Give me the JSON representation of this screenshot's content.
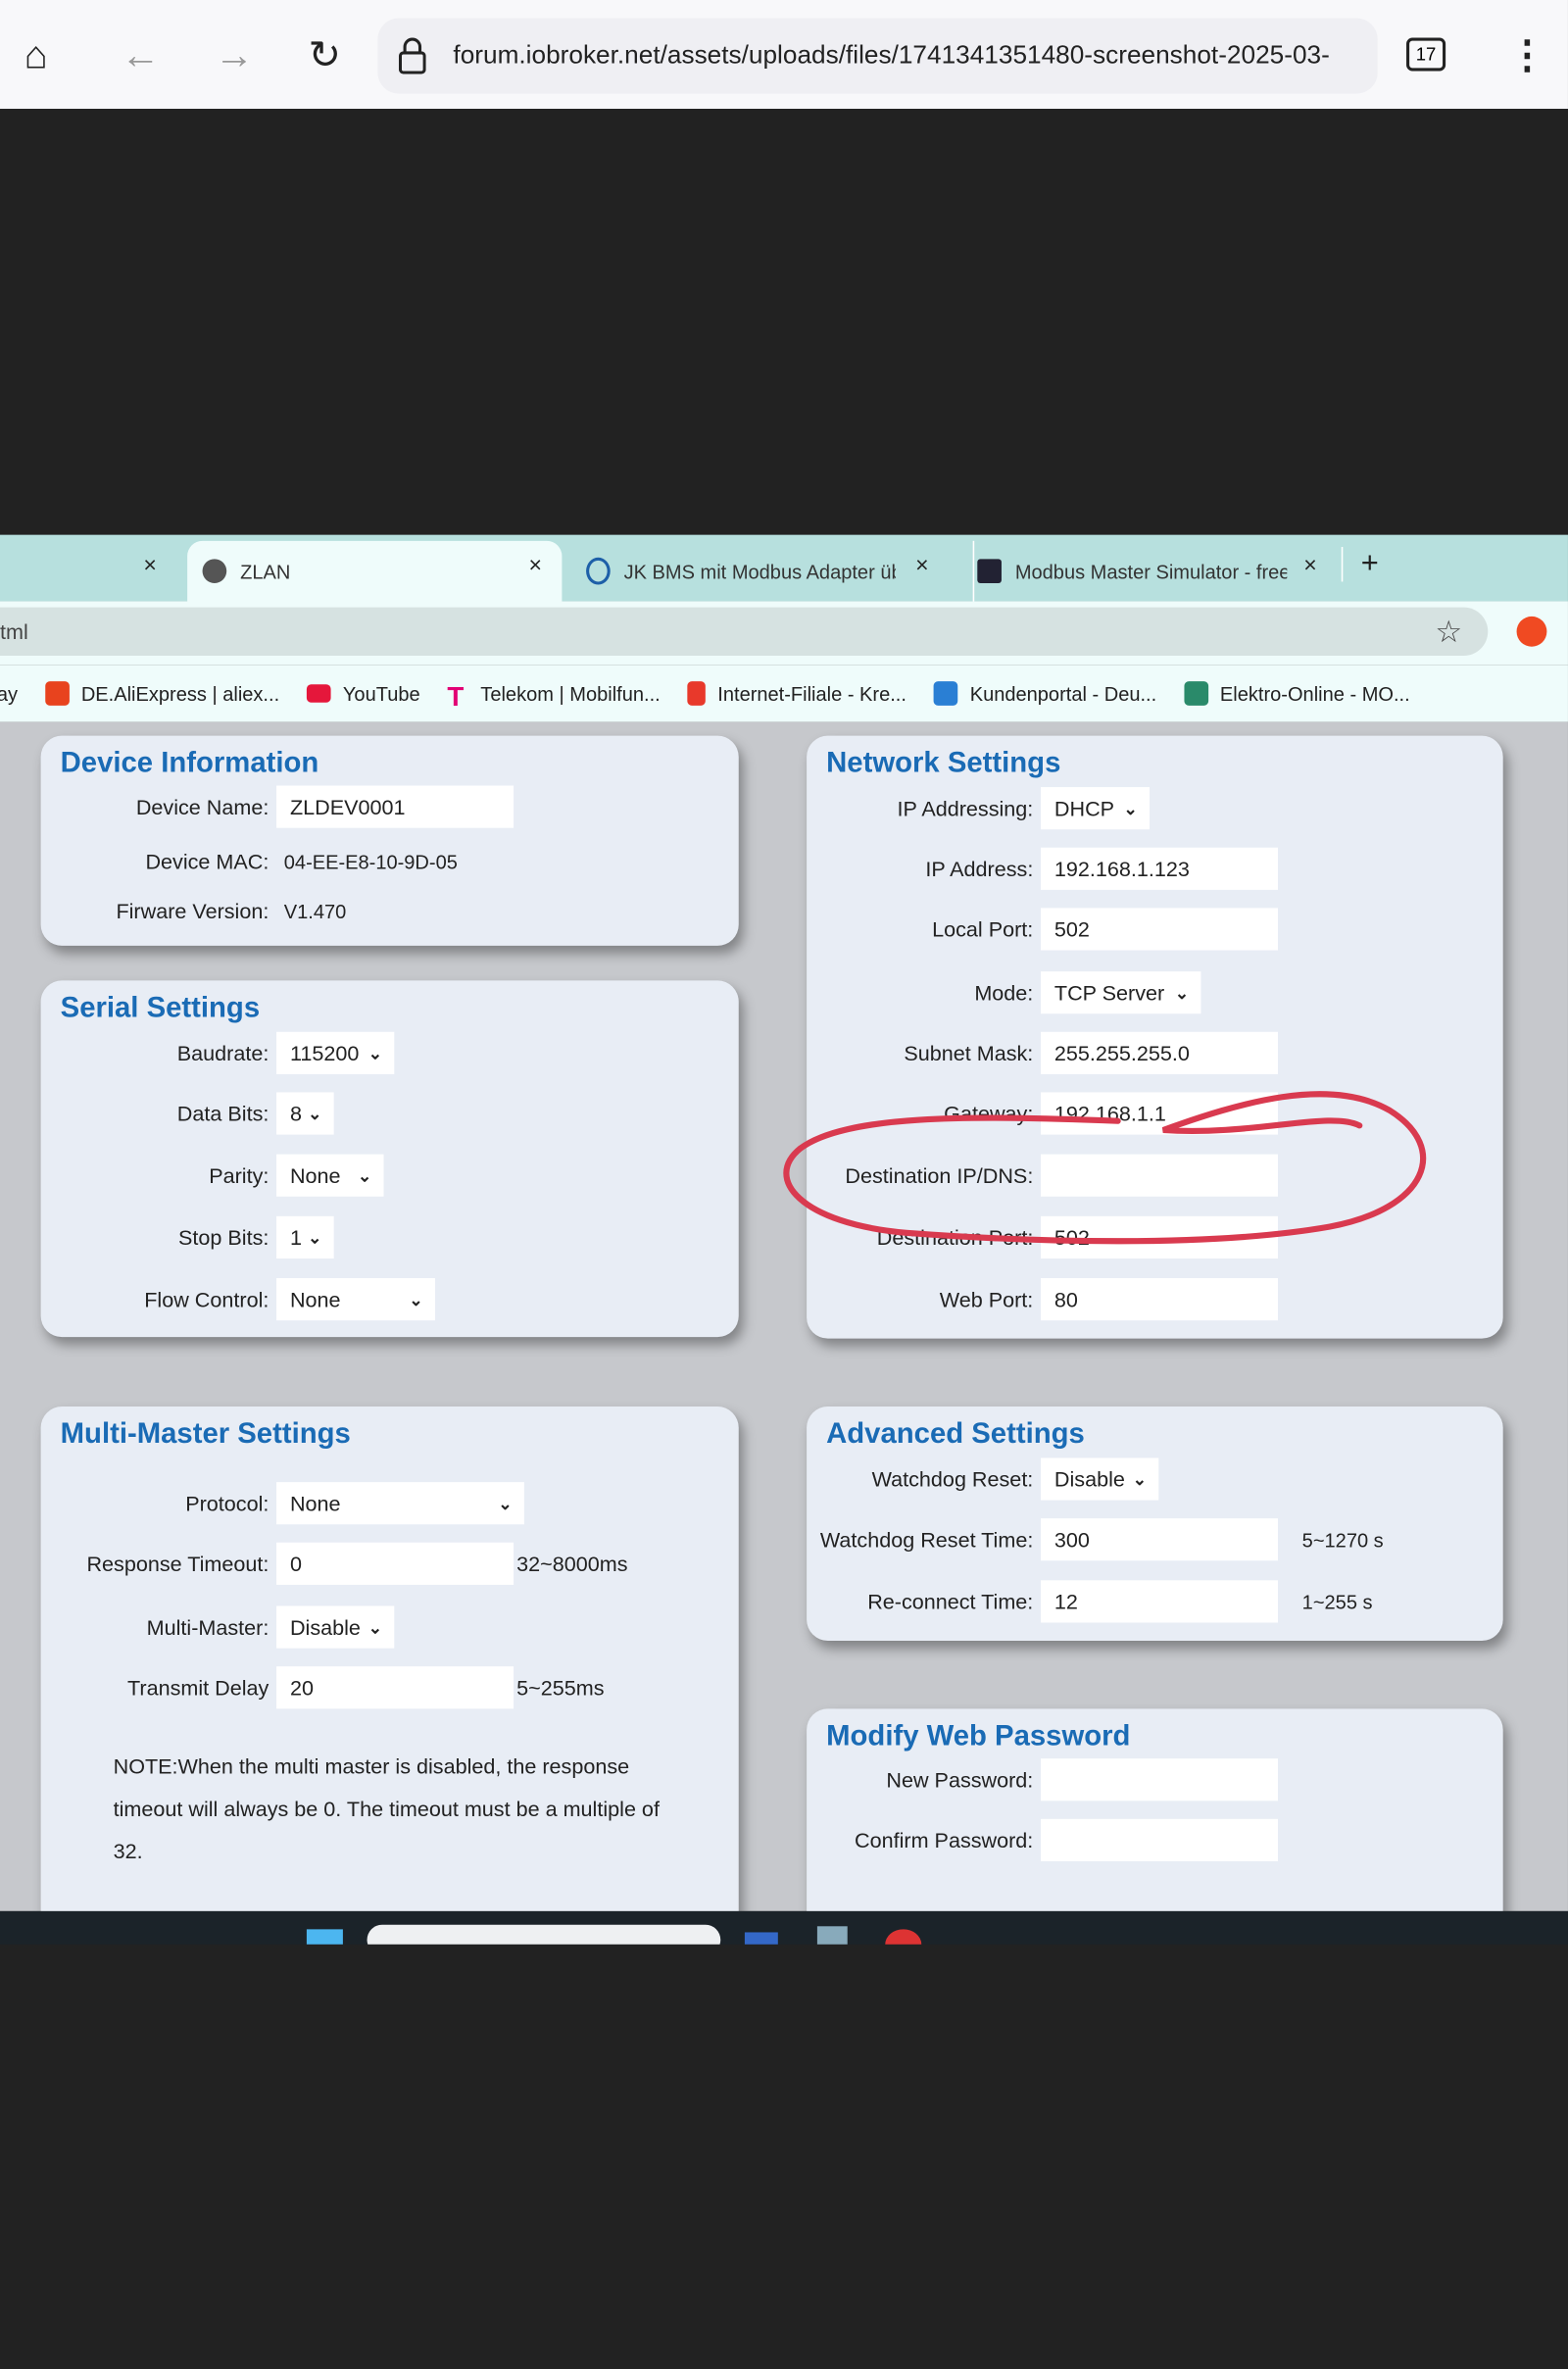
{
  "browser": {
    "url": "forum.iobroker.net/assets/uploads/files/1741341351480-screenshot-2025-03-",
    "tab_count": "17",
    "icons": [
      "home-icon",
      "back-icon",
      "forward-icon",
      "reload-icon",
      "lock-icon",
      "tabs-icon",
      "menu-icon"
    ]
  },
  "inner_browser": {
    "tabs": [
      {
        "label": "ZLAN",
        "active": true
      },
      {
        "label": "JK BMS mit Modbus Adapter üb",
        "active": false
      },
      {
        "label": "Modbus Master Simulator - free",
        "active": false
      }
    ],
    "close_glyph": "×",
    "new_tab_glyph": "+",
    "address_text": "tml",
    "bookmarks": [
      {
        "label": "ay",
        "color": ""
      },
      {
        "label": "DE.AliExpress | aliex...",
        "color": "#e8431e"
      },
      {
        "label": "YouTube",
        "color": "#e5173b"
      },
      {
        "label": "Telekom | Mobilfun...",
        "color": "#e20074"
      },
      {
        "label": "Internet-Filiale - Kre...",
        "color": "#e8392b"
      },
      {
        "label": "Kundenportal - Deu...",
        "color": "#2a7fd4"
      },
      {
        "label": "Elektro-Online - MO...",
        "color": "#2a8a6a"
      }
    ]
  },
  "device_info": {
    "title": "Device Information",
    "device_name_label": "Device Name:",
    "device_name": "ZLDEV0001",
    "mac_label": "Device MAC:",
    "mac": "04-EE-E8-10-9D-05",
    "fw_label": "Firware Version:",
    "fw": "V1.470"
  },
  "serial": {
    "title": "Serial Settings",
    "baudrate_label": "Baudrate:",
    "baudrate": "115200",
    "databits_label": "Data Bits:",
    "databits": "8",
    "parity_label": "Parity:",
    "parity": "None",
    "stopbits_label": "Stop Bits:",
    "stopbits": "1",
    "flow_label": "Flow Control:",
    "flow": "None"
  },
  "multi_master": {
    "title": "Multi-Master Settings",
    "protocol_label": "Protocol:",
    "protocol": "None",
    "timeout_label": "Response Timeout:",
    "timeout": "0",
    "timeout_hint": "32~8000ms",
    "mm_label": "Multi-Master:",
    "mm": "Disable",
    "delay_label": "Transmit Delay",
    "delay": "20",
    "delay_hint": "5~255ms",
    "note": "NOTE:When the multi master is disabled, the response timeout will always be 0. The timeout must be a multiple of 32."
  },
  "network": {
    "title": "Network Settings",
    "ip_mode_label": "IP Addressing:",
    "ip_mode": "DHCP",
    "ip_label": "IP Address:",
    "ip": "192.168.1.123",
    "port_label": "Local Port:",
    "port": "502",
    "mode_label": "Mode:",
    "mode": "TCP Server",
    "mask_label": "Subnet Mask:",
    "mask": "255.255.255.0",
    "gw_label": "Gateway:",
    "gw": "192.168.1.1",
    "dest_ip_label": "Destination IP/DNS:",
    "dest_ip": "",
    "dest_port_label": "Destination Port:",
    "dest_port": "502",
    "web_port_label": "Web Port:",
    "web_port": "80"
  },
  "advanced": {
    "title": "Advanced Settings",
    "wd_label": "Watchdog Reset:",
    "wd": "Disable",
    "wdt_label": "Watchdog Reset Time:",
    "wdt": "300",
    "wdt_hint": "5~1270 s",
    "rc_label": "Re-connect Time:",
    "rc": "12",
    "rc_hint": "1~255 s"
  },
  "password": {
    "title": "Modify Web Password",
    "new_label": "New Password:",
    "new": "",
    "confirm_label": "Confirm Password:",
    "confirm": ""
  },
  "annotation": {
    "color": "#d93a4f",
    "shape": "hand-drawn red circle around Destination IP/DNS and Destination Port"
  },
  "colors": {
    "heading": "#1a6bb5",
    "panel": "#e8edf5",
    "tabstrip": "#b7e0de"
  }
}
